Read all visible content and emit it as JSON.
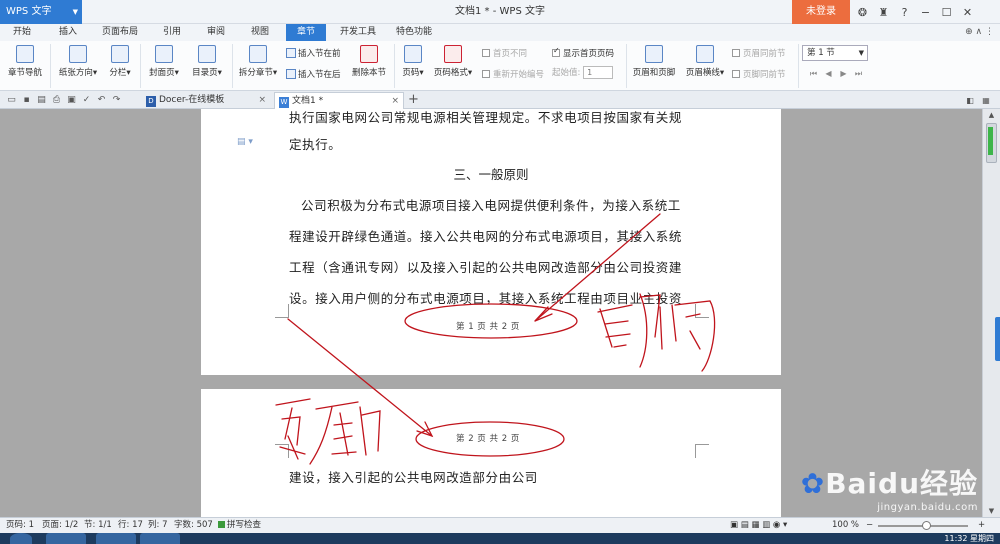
{
  "app": {
    "name": "WPS 文字",
    "window_title": "文档1 * - WPS 文字",
    "login": "未登录"
  },
  "menu": {
    "tabs": [
      "开始",
      "插入",
      "页面布局",
      "引用",
      "审阅",
      "视图",
      "章节",
      "开发工具",
      "特色功能"
    ],
    "active": "章节"
  },
  "ribbon": {
    "chapter_nav": "章节导航",
    "paper_orientation": "纸张方向",
    "columns": "分栏",
    "cover": "封面页",
    "toc": "目录页",
    "split_chapter": "拆分章节",
    "insert_before": "插入节在前",
    "insert_after": "插入节在后",
    "delete_section": "删除本节",
    "first_page_diff": "首页不同",
    "show_first_page_num": "显示首页页码",
    "restart_num": "重新开始编号",
    "start_value_label": "起始值:",
    "start_value": "1",
    "page_num": "页码",
    "page_num_format": "页码格式",
    "header_footer": "页眉和页脚",
    "header_line": "页眉横线",
    "header_same_prev": "页眉同前节",
    "footer_same_prev": "页脚同前节",
    "section_select": "第 1 节"
  },
  "doc_tabs": {
    "tab1": "Docer-在线模板",
    "tab2": "文档1 *"
  },
  "document": {
    "line_top": "执行国家电网公司常规电源相关管理规定。不求电项目按国家有关规",
    "line_2": "定执行。",
    "heading": "三、一般原则",
    "para1": "公司积极为分布式电源项目接入电网提供便利条件，为接入系统工",
    "para2": "程建设开辟绿色通道。接入公共电网的分布式电源项目，其接入系统",
    "para3": "工程（含通讯专网）以及接入引起的公共电网改造部分由公司投资建",
    "para4": "设。接入用户侧的分布式电源项目，其接入系统工程由项目业主投资",
    "footer_p1": "第 1 页 共 2 页",
    "header_p2": "第 2 页 共 2 页",
    "page2_line": "建设，接入引起的公共电网改造部分由公司"
  },
  "annotations": {
    "footer_label": "页脚",
    "header_label": "页眉"
  },
  "watermark": {
    "brand": "Baidu经验",
    "url": "jingyan.baidu.com"
  },
  "status": {
    "page": "页码: 1",
    "pages": "页面: 1/2",
    "section": "节: 1/1",
    "row": "行: 17",
    "col": "列: 7",
    "words": "字数: 507",
    "spell": "拼写检查",
    "zoom": "100 %"
  },
  "taskbar": {
    "time": "11:32 星期四"
  },
  "colors": {
    "brand_blue": "#2f7bd3",
    "login_orange": "#ec6d3e",
    "ink_red": "#c0141c"
  }
}
